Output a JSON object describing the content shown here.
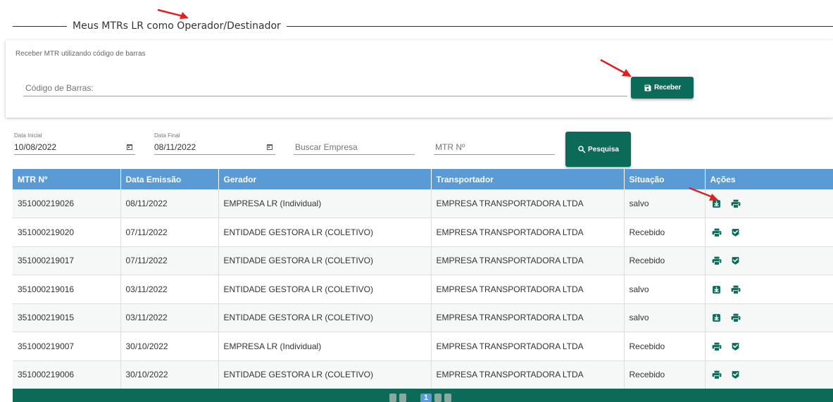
{
  "title": "Meus MTRs LR como Operador/Destinador",
  "barcode_card": {
    "label": "Receber MTR utilizando código de barras",
    "input_placeholder": "Código de Barras:",
    "input_value": "",
    "receive_button": "Receber"
  },
  "filters": {
    "start_date_label": "Data Inicial",
    "start_date_value": "10/08/2022",
    "end_date_label": "Data Final",
    "end_date_value": "08/11/2022",
    "company_placeholder": "Buscar Empresa",
    "mtr_placeholder": "MTR Nº",
    "search_button": "Pesquisa"
  },
  "table": {
    "columns": [
      "MTR Nº",
      "Data Emissão",
      "Gerador",
      "Transportador",
      "Situação",
      "Ações"
    ],
    "rows": [
      {
        "mtr": "351000219026",
        "date": "08/11/2022",
        "generator": "EMPRESA LR (Individual)",
        "carrier": "EMPRESA TRANSPORTADORA LTDA",
        "status": "salvo",
        "actions": [
          "receive-icon",
          "print-icon"
        ]
      },
      {
        "mtr": "351000219020",
        "date": "07/11/2022",
        "generator": "ENTIDADE GESTORA LR (COLETIVO)",
        "carrier": "EMPRESA TRANSPORTADORA LTDA",
        "status": "Recebido",
        "actions": [
          "print-icon",
          "verified-icon"
        ]
      },
      {
        "mtr": "351000219017",
        "date": "07/11/2022",
        "generator": "ENTIDADE GESTORA LR (COLETIVO)",
        "carrier": "EMPRESA TRANSPORTADORA LTDA",
        "status": "Recebido",
        "actions": [
          "print-icon",
          "verified-icon"
        ]
      },
      {
        "mtr": "351000219016",
        "date": "03/11/2022",
        "generator": "ENTIDADE GESTORA LR (COLETIVO)",
        "carrier": "EMPRESA TRANSPORTADORA LTDA",
        "status": "salvo",
        "actions": [
          "receive-icon",
          "print-icon"
        ]
      },
      {
        "mtr": "351000219015",
        "date": "03/11/2022",
        "generator": "ENTIDADE GESTORA LR (COLETIVO)",
        "carrier": "EMPRESA TRANSPORTADORA LTDA",
        "status": "salvo",
        "actions": [
          "receive-icon",
          "print-icon"
        ]
      },
      {
        "mtr": "351000219007",
        "date": "30/10/2022",
        "generator": "EMPRESA LR (Individual)",
        "carrier": "EMPRESA TRANSPORTADORA LTDA",
        "status": "Recebido",
        "actions": [
          "print-icon",
          "verified-icon"
        ]
      },
      {
        "mtr": "351000219006",
        "date": "30/10/2022",
        "generator": "ENTIDADE GESTORA LR (COLETIVO)",
        "carrier": "EMPRESA TRANSPORTADORA LTDA",
        "status": "Recebido",
        "actions": [
          "print-icon",
          "verified-icon"
        ]
      }
    ]
  },
  "pagination": {
    "current_page": "1",
    "controls": [
      "first-page-icon",
      "prev-page-icon",
      "next-page-icon",
      "last-page-icon"
    ]
  },
  "colors": {
    "primary_green": "#0b6b58",
    "header_blue": "#5b9bd5",
    "annotation_red": "#e02020"
  }
}
